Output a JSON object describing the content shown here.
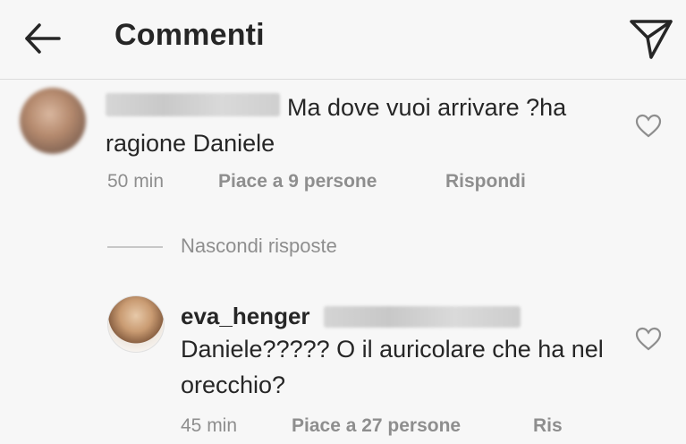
{
  "header": {
    "title": "Commenti",
    "back_icon": "arrow-left-icon",
    "send_icon": "paper-plane-icon"
  },
  "comment1": {
    "text": "Ma dove vuoi arrivare ?ha ragione Daniele",
    "time": "50 min",
    "likes": "Piace a 9 persone",
    "reply": "Rispondi"
  },
  "replies_toggle": "Nascondi risposte",
  "comment2": {
    "username": "eva_henger",
    "text": "Daniele????? O il auricolare che ha nel orecchio?",
    "time": "45 min",
    "likes": "Piace a 27 persone",
    "reply": "Ris"
  },
  "colors": {
    "background": "#f7f7f7",
    "text": "#262626",
    "secondary_text": "#8e8e8e"
  }
}
